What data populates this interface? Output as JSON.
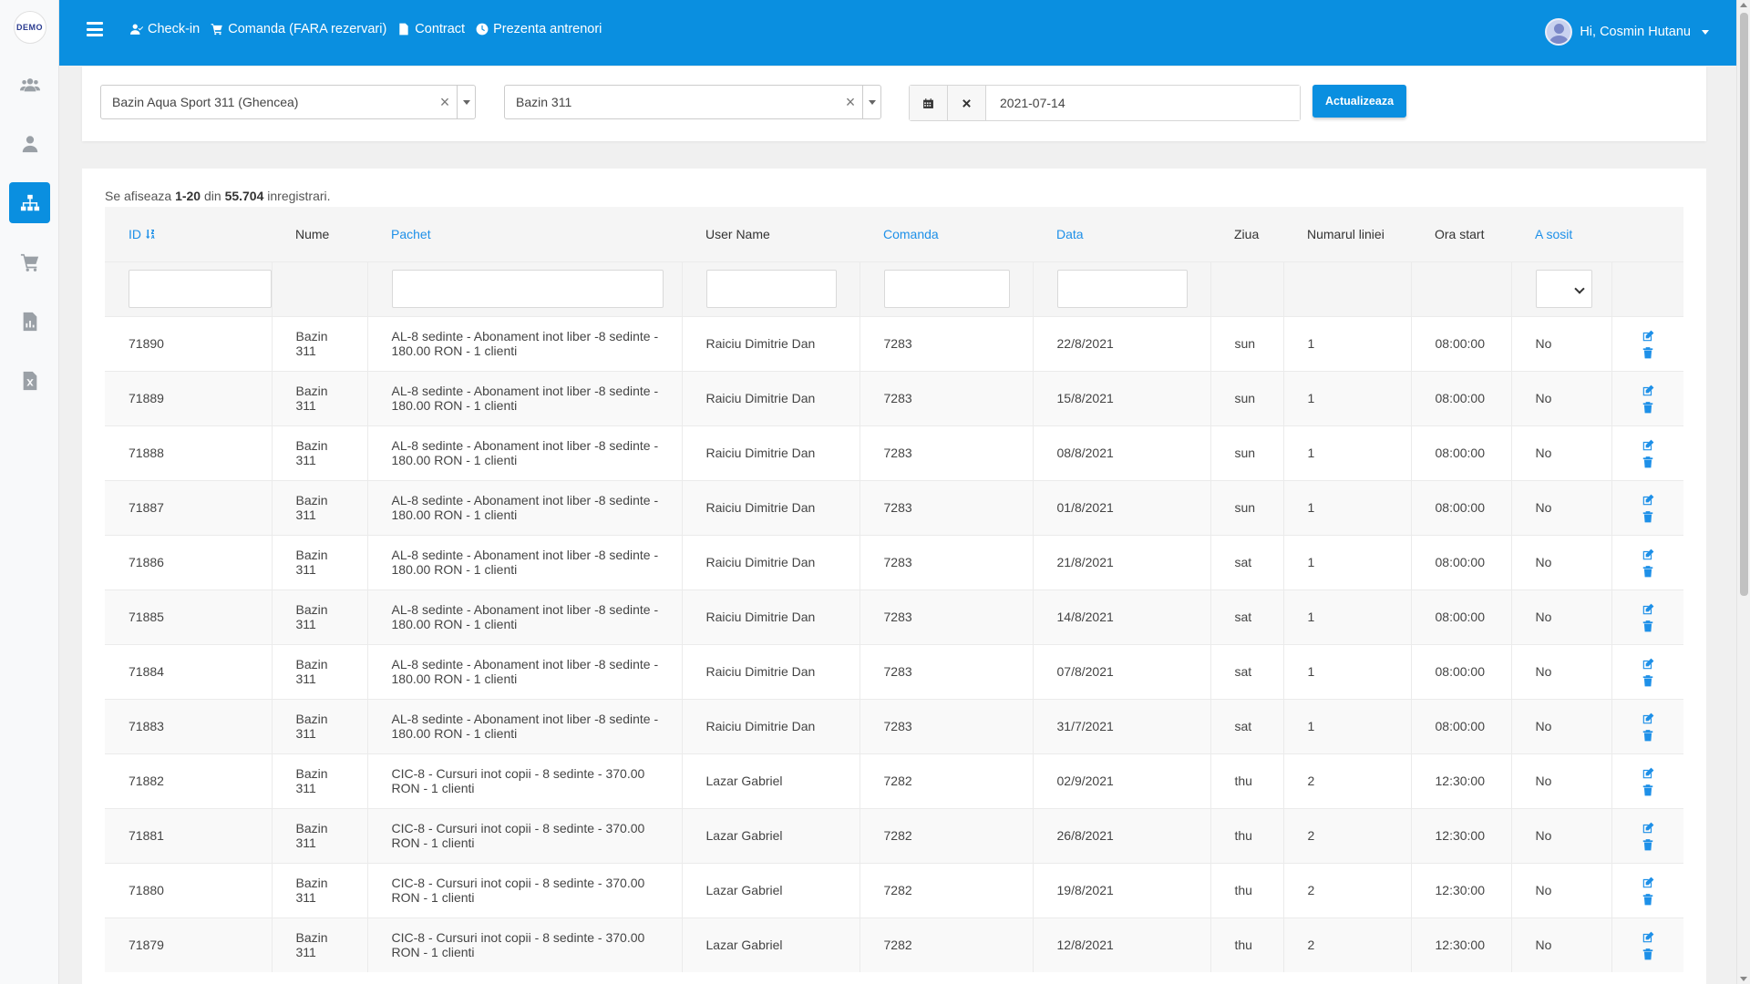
{
  "sidebar": {
    "logo_text": "DEMO",
    "items": [
      {
        "icon": "users-group-icon"
      },
      {
        "icon": "user-icon"
      },
      {
        "icon": "sitemap-icon"
      },
      {
        "icon": "cart-icon"
      },
      {
        "icon": "file-chart-icon"
      },
      {
        "icon": "file-excel-icon"
      }
    ]
  },
  "topbar": {
    "nav": [
      {
        "label": "Check-in",
        "icon": "user-check-icon"
      },
      {
        "label": "Comanda (FARA rezervari)",
        "icon": "cart-icon"
      },
      {
        "label": "Contract",
        "icon": "file-icon"
      },
      {
        "label": "Prezenta antrenori",
        "icon": "clock-icon"
      }
    ],
    "user_greeting": "Hi, Cosmin Hutanu"
  },
  "filters": {
    "location": "Bazin Aqua Sport 311 (Ghencea)",
    "pool": "Bazin 311",
    "date": "2021-07-14",
    "update_label": "Actualizeaza"
  },
  "summary": {
    "prefix": "Se afiseaza",
    "range": "1-20",
    "middle": "din",
    "total": "55.704",
    "suffix": "inregistrari."
  },
  "table": {
    "headers": {
      "id": "ID",
      "nume": "Nume",
      "pachet": "Pachet",
      "username": "User Name",
      "comanda": "Comanda",
      "data": "Data",
      "ziua": "Ziua",
      "linie": "Numarul liniei",
      "ora": "Ora start",
      "sosit": "A sosit"
    },
    "rows": [
      {
        "id": "71890",
        "nume": "Bazin 311",
        "pachet": "AL-8 sedinte - Abonament inot liber -8 sedinte - 180.00 RON - 1 clienti",
        "username": "Raiciu Dimitrie Dan",
        "comanda": "7283",
        "data": "22/8/2021",
        "ziua": "sun",
        "linie": "1",
        "ora": "08:00:00",
        "sosit": "No"
      },
      {
        "id": "71889",
        "nume": "Bazin 311",
        "pachet": "AL-8 sedinte - Abonament inot liber -8 sedinte - 180.00 RON - 1 clienti",
        "username": "Raiciu Dimitrie Dan",
        "comanda": "7283",
        "data": "15/8/2021",
        "ziua": "sun",
        "linie": "1",
        "ora": "08:00:00",
        "sosit": "No"
      },
      {
        "id": "71888",
        "nume": "Bazin 311",
        "pachet": "AL-8 sedinte - Abonament inot liber -8 sedinte - 180.00 RON - 1 clienti",
        "username": "Raiciu Dimitrie Dan",
        "comanda": "7283",
        "data": "08/8/2021",
        "ziua": "sun",
        "linie": "1",
        "ora": "08:00:00",
        "sosit": "No"
      },
      {
        "id": "71887",
        "nume": "Bazin 311",
        "pachet": "AL-8 sedinte - Abonament inot liber -8 sedinte - 180.00 RON - 1 clienti",
        "username": "Raiciu Dimitrie Dan",
        "comanda": "7283",
        "data": "01/8/2021",
        "ziua": "sun",
        "linie": "1",
        "ora": "08:00:00",
        "sosit": "No"
      },
      {
        "id": "71886",
        "nume": "Bazin 311",
        "pachet": "AL-8 sedinte - Abonament inot liber -8 sedinte - 180.00 RON - 1 clienti",
        "username": "Raiciu Dimitrie Dan",
        "comanda": "7283",
        "data": "21/8/2021",
        "ziua": "sat",
        "linie": "1",
        "ora": "08:00:00",
        "sosit": "No"
      },
      {
        "id": "71885",
        "nume": "Bazin 311",
        "pachet": "AL-8 sedinte - Abonament inot liber -8 sedinte - 180.00 RON - 1 clienti",
        "username": "Raiciu Dimitrie Dan",
        "comanda": "7283",
        "data": "14/8/2021",
        "ziua": "sat",
        "linie": "1",
        "ora": "08:00:00",
        "sosit": "No"
      },
      {
        "id": "71884",
        "nume": "Bazin 311",
        "pachet": "AL-8 sedinte - Abonament inot liber -8 sedinte - 180.00 RON - 1 clienti",
        "username": "Raiciu Dimitrie Dan",
        "comanda": "7283",
        "data": "07/8/2021",
        "ziua": "sat",
        "linie": "1",
        "ora": "08:00:00",
        "sosit": "No"
      },
      {
        "id": "71883",
        "nume": "Bazin 311",
        "pachet": "AL-8 sedinte - Abonament inot liber -8 sedinte - 180.00 RON - 1 clienti",
        "username": "Raiciu Dimitrie Dan",
        "comanda": "7283",
        "data": "31/7/2021",
        "ziua": "sat",
        "linie": "1",
        "ora": "08:00:00",
        "sosit": "No"
      },
      {
        "id": "71882",
        "nume": "Bazin 311",
        "pachet": "CIC-8 - Cursuri inot copii - 8 sedinte - 370.00 RON - 1 clienti",
        "username": "Lazar Gabriel",
        "comanda": "7282",
        "data": "02/9/2021",
        "ziua": "thu",
        "linie": "2",
        "ora": "12:30:00",
        "sosit": "No"
      },
      {
        "id": "71881",
        "nume": "Bazin 311",
        "pachet": "CIC-8 - Cursuri inot copii - 8 sedinte - 370.00 RON - 1 clienti",
        "username": "Lazar Gabriel",
        "comanda": "7282",
        "data": "26/8/2021",
        "ziua": "thu",
        "linie": "2",
        "ora": "12:30:00",
        "sosit": "No"
      },
      {
        "id": "71880",
        "nume": "Bazin 311",
        "pachet": "CIC-8 - Cursuri inot copii - 8 sedinte - 370.00 RON - 1 clienti",
        "username": "Lazar Gabriel",
        "comanda": "7282",
        "data": "19/8/2021",
        "ziua": "thu",
        "linie": "2",
        "ora": "12:30:00",
        "sosit": "No"
      },
      {
        "id": "71879",
        "nume": "Bazin 311",
        "pachet": "CIC-8 - Cursuri inot copii - 8 sedinte - 370.00 RON - 1 clienti",
        "username": "Lazar Gabriel",
        "comanda": "7282",
        "data": "12/8/2021",
        "ziua": "thu",
        "linie": "2",
        "ora": "12:30:00",
        "sosit": "No"
      }
    ]
  },
  "colors": {
    "primary": "#0a8fe0",
    "link": "#1e90e8"
  }
}
